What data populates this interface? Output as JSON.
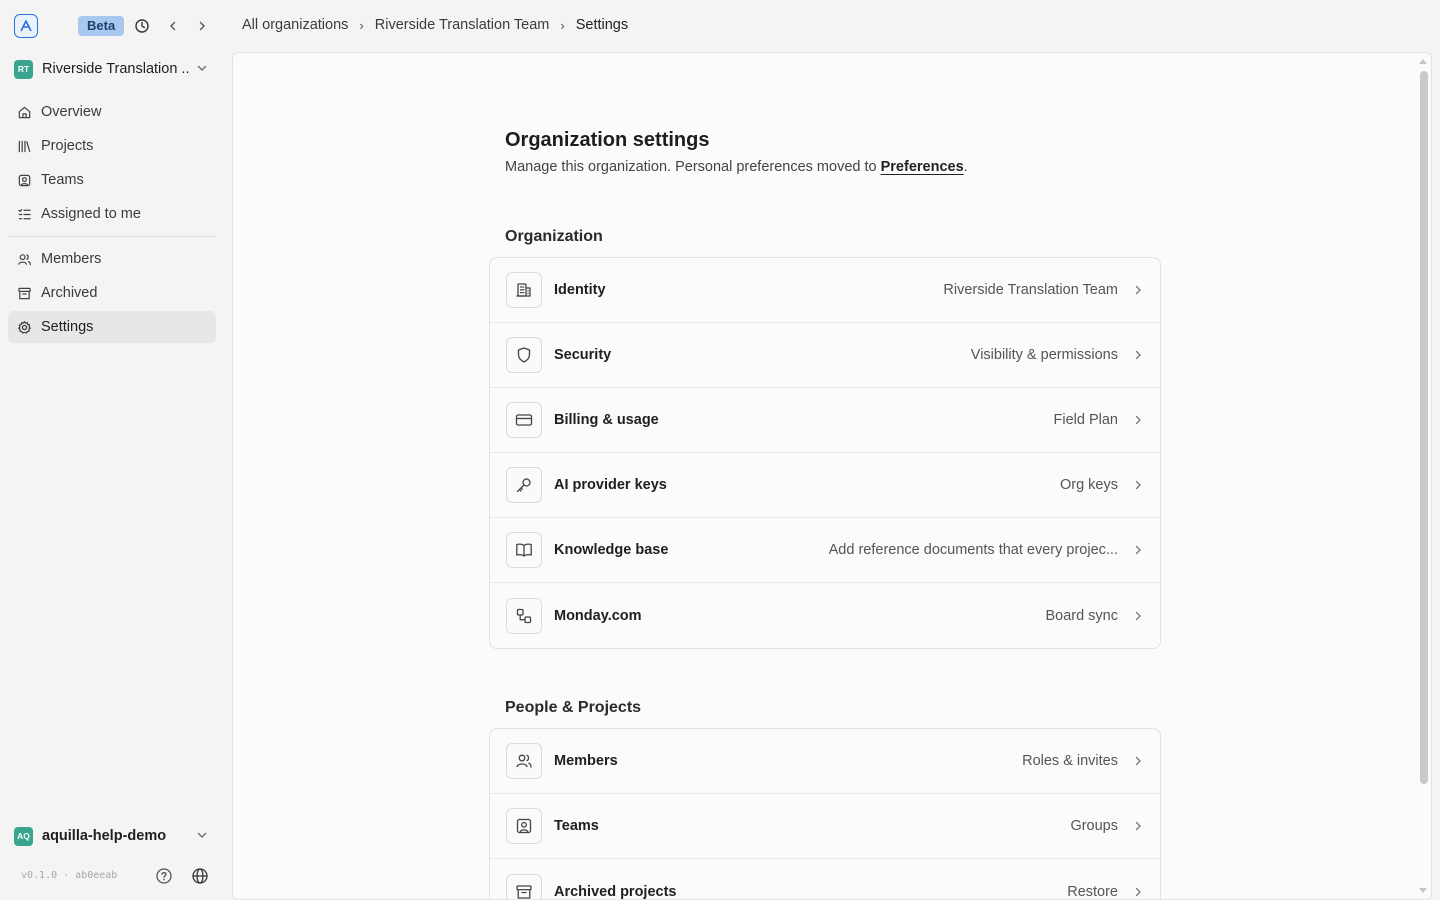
{
  "topbar": {
    "beta_label": "Beta",
    "breadcrumb": [
      "All organizations",
      "Riverside Translation Team",
      "Settings"
    ],
    "breadcrumb_sep": "›"
  },
  "sidebar": {
    "org": {
      "initials": "RT",
      "name": "Riverside Translation ..."
    },
    "nav_primary": [
      {
        "label": "Overview",
        "icon": "home-icon"
      },
      {
        "label": "Projects",
        "icon": "library-icon"
      },
      {
        "label": "Teams",
        "icon": "contact-square-icon"
      },
      {
        "label": "Assigned to me",
        "icon": "list-check-icon"
      }
    ],
    "nav_secondary": [
      {
        "label": "Members",
        "icon": "users-icon"
      },
      {
        "label": "Archived",
        "icon": "archive-icon"
      },
      {
        "label": "Settings",
        "icon": "gear-icon",
        "active": true
      }
    ],
    "workspace": {
      "initials": "AQ",
      "name": "aquilla-help-demo"
    },
    "version": "v0.1.0 · ab0eeab"
  },
  "main": {
    "title": "Organization settings",
    "subtitle_text": "Manage this organization. Personal preferences moved to ",
    "subtitle_link": "Preferences",
    "subtitle_end": ".",
    "sections": [
      {
        "title": "Organization",
        "rows": [
          {
            "label": "Identity",
            "value": "Riverside Translation Team",
            "icon": "building-icon"
          },
          {
            "label": "Security",
            "value": "Visibility & permissions",
            "icon": "shield-icon"
          },
          {
            "label": "Billing & usage",
            "value": "Field Plan",
            "icon": "credit-card-icon"
          },
          {
            "label": "AI provider keys",
            "value": "Org keys",
            "icon": "key-icon"
          },
          {
            "label": "Knowledge base",
            "value": "Add reference documents that every projec...",
            "icon": "book-open-icon"
          },
          {
            "label": "Monday.com",
            "value": "Board sync",
            "icon": "workflow-icon"
          }
        ]
      },
      {
        "title": "People & Projects",
        "rows": [
          {
            "label": "Members",
            "value": "Roles & invites",
            "icon": "users-icon"
          },
          {
            "label": "Teams",
            "value": "Groups",
            "icon": "contact-square-icon"
          },
          {
            "label": "Archived projects",
            "value": "Restore",
            "icon": "archive-icon"
          }
        ]
      }
    ]
  },
  "colors": {
    "accent": "#2d6fd6",
    "beta_badge_bg": "#a9c8ef",
    "org_avatar": "#3aa58f",
    "active_nav_bg": "#e7e7e7"
  }
}
